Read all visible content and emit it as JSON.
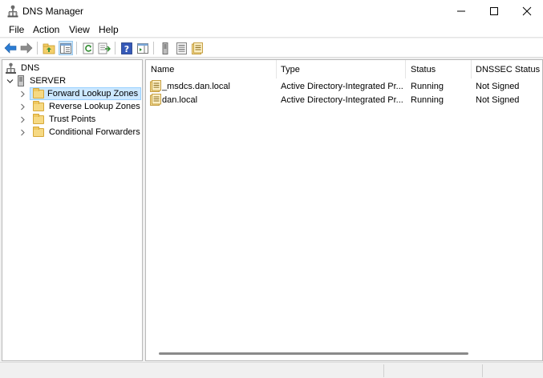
{
  "window": {
    "title": "DNS Manager",
    "app_icon": "dns-manager-icon"
  },
  "menu": {
    "items": [
      "File",
      "Action",
      "View",
      "Help"
    ]
  },
  "toolbar": {
    "buttons": [
      "back-arrow-icon",
      "forward-arrow-icon",
      "up-folder-icon",
      "show-hide-console-tree-icon",
      "refresh-icon",
      "export-list-icon",
      "help-icon",
      "show-action-pane-icon",
      "server-icon",
      "list-icon",
      "zone-icon"
    ]
  },
  "tree": {
    "root": "DNS",
    "server": "SERVER",
    "children": [
      "Forward Lookup Zones",
      "Reverse Lookup Zones",
      "Trust Points",
      "Conditional Forwarders"
    ],
    "selected": "Forward Lookup Zones"
  },
  "list": {
    "columns": [
      "Name",
      "Type",
      "Status",
      "DNSSEC Status"
    ],
    "rows": [
      {
        "name": "_msdcs.dan.local",
        "type": "Active Directory-Integrated Pr...",
        "status": "Running",
        "dnssec": "Not Signed"
      },
      {
        "name": "dan.local",
        "type": "Active Directory-Integrated Pr...",
        "status": "Running",
        "dnssec": "Not Signed"
      }
    ]
  },
  "colors": {
    "selection_bg": "#cce8ff",
    "selection_border": "#99d1ff",
    "folder": "#f6d983"
  }
}
